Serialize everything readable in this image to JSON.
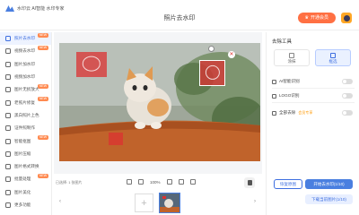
{
  "app": {
    "name": "水印云 AI智能 水印专家",
    "title": "照片去水印"
  },
  "header": {
    "open_vip_label": "开通会员"
  },
  "sidebar": {
    "items": [
      {
        "label": "照片去水印",
        "badge": "NEW",
        "active": true
      },
      {
        "label": "视频去水印",
        "badge": "NEW",
        "active": false
      },
      {
        "label": "图片加水印",
        "badge": "",
        "active": false
      },
      {
        "label": "视频加水印",
        "badge": "",
        "active": false
      },
      {
        "label": "图片无损放大",
        "badge": "NEW",
        "active": false
      },
      {
        "label": "老照片修复",
        "badge": "NEW",
        "active": false
      },
      {
        "label": "黑白照片上色",
        "badge": "",
        "active": false
      },
      {
        "label": "证件照制作",
        "badge": "",
        "active": false
      },
      {
        "label": "智能抠图",
        "badge": "NEW",
        "active": false
      },
      {
        "label": "图片压缩",
        "badge": "",
        "active": false
      },
      {
        "label": "图片格式转换",
        "badge": "",
        "active": false
      },
      {
        "label": "批量处理",
        "badge": "NEW",
        "active": false
      },
      {
        "label": "图片美化",
        "badge": "",
        "active": false
      },
      {
        "label": "更多功能",
        "badge": "",
        "active": false
      }
    ]
  },
  "toolbar": {
    "info": "已选择: 1 张图片",
    "zoom": "100%"
  },
  "panel": {
    "title": "去除工具",
    "modes": [
      {
        "label": "涂抹",
        "active": false
      },
      {
        "label": "框选",
        "active": true
      }
    ],
    "options": [
      {
        "label": "AI智能识别",
        "vip": ""
      },
      {
        "label": "LOGO识别",
        "vip": ""
      },
      {
        "label": "全部去除",
        "vip": "会员专享"
      }
    ],
    "buttons": {
      "restore": "恢复原图",
      "start": "开始去水印(1/10)",
      "download": "下载当前图片(1/10)"
    }
  },
  "colors": {
    "accent": "#4a7fe0",
    "vip": "#ff7043",
    "watermark": "#dc3232"
  }
}
